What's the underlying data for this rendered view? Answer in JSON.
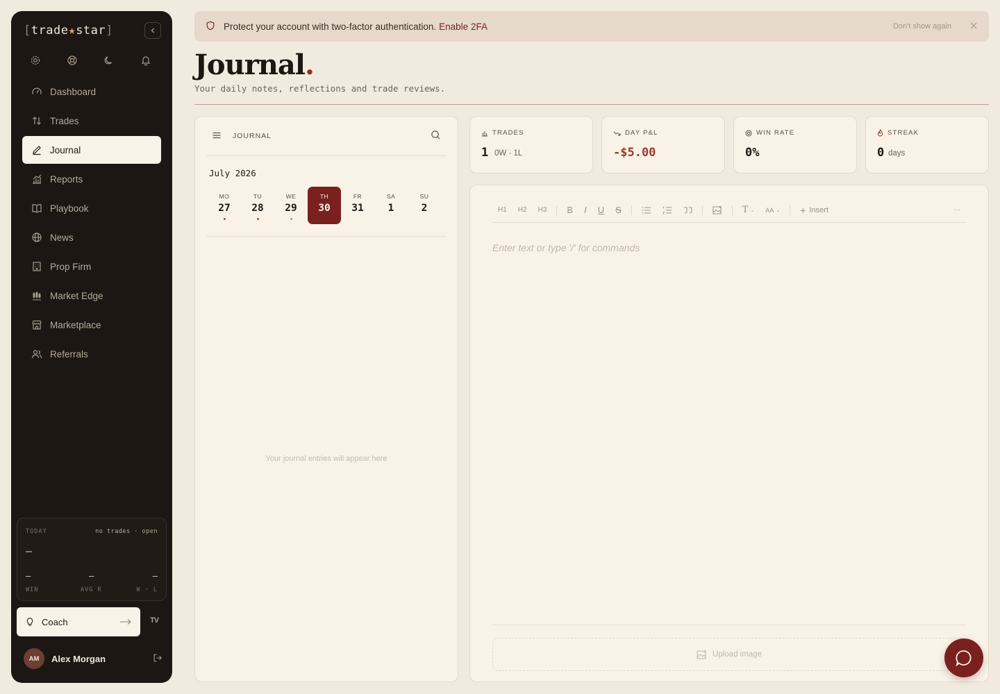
{
  "app": {
    "logo_word1": "trade",
    "logo_word2": "star",
    "logo_open": "[",
    "logo_close": "]"
  },
  "sidebar": {
    "utilities": [
      "gear-icon",
      "lifebuoy-icon",
      "moon-icon",
      "bell-icon"
    ],
    "items": [
      {
        "label": "Dashboard",
        "icon": "gauge-icon"
      },
      {
        "label": "Trades",
        "icon": "arrows-updown-icon"
      },
      {
        "label": "Journal",
        "icon": "pencil-icon"
      },
      {
        "label": "Reports",
        "icon": "chart-icon"
      },
      {
        "label": "Playbook",
        "icon": "book-icon"
      },
      {
        "label": "News",
        "icon": "globe-icon"
      },
      {
        "label": "Prop Firm",
        "icon": "building-icon"
      },
      {
        "label": "Market Edge",
        "icon": "candles-icon"
      },
      {
        "label": "Marketplace",
        "icon": "store-icon"
      },
      {
        "label": "Referrals",
        "icon": "users-icon"
      }
    ],
    "active_index": 2,
    "today": {
      "label": "TODAY",
      "status": "no trades · open",
      "main_value": "—",
      "stats": [
        {
          "value": "—",
          "label": "WIN"
        },
        {
          "value": "—",
          "label": "AVG R"
        },
        {
          "value": "—",
          "label": "W · L"
        }
      ]
    },
    "coach_label": "Coach",
    "tv_logo": "TV",
    "user": {
      "initials": "AM",
      "name": "Alex Morgan"
    }
  },
  "banner": {
    "text": "Protect your account with two-factor authentication.",
    "link": "Enable 2FA",
    "dismiss": "Don't show again"
  },
  "page": {
    "title": "Journal",
    "title_dot": ".",
    "subtitle": "Your daily notes, reflections and trade reviews."
  },
  "calendar": {
    "header_label": "JOURNAL",
    "month": "July 2026",
    "days": [
      {
        "dow": "MO",
        "date": "27",
        "mark": true
      },
      {
        "dow": "TU",
        "date": "28",
        "mark": true
      },
      {
        "dow": "WE",
        "date": "29",
        "mark": true
      },
      {
        "dow": "TH",
        "date": "30",
        "mark": false
      },
      {
        "dow": "FR",
        "date": "31",
        "mark": false
      },
      {
        "dow": "SA",
        "date": "1",
        "mark": false
      },
      {
        "dow": "SU",
        "date": "2",
        "mark": false
      }
    ],
    "selected_index": 3,
    "empty_text": "Your journal entries will appear here"
  },
  "stats": [
    {
      "label": "TRADES",
      "icon": "bar-chart-icon",
      "value": "1",
      "sub": "0W · 1L"
    },
    {
      "label": "DAY P&L",
      "icon": "trend-down-icon",
      "value": "-$5.00",
      "sub": ""
    },
    {
      "label": "WIN RATE",
      "icon": "target-icon",
      "value": "0%",
      "sub": ""
    },
    {
      "label": "STREAK",
      "icon": "flame-icon",
      "value": "0",
      "sub": "days"
    }
  ],
  "editor": {
    "toolbar": {
      "h1": "H1",
      "h2": "H2",
      "h3": "H3",
      "bold": "B",
      "italic": "I",
      "underline": "U",
      "strike": "S",
      "text_type": "T",
      "font_size": "AA",
      "insert": "Insert",
      "more": "···"
    },
    "placeholder": "Enter text or type '/' for commands",
    "upload_label": "Upload image"
  },
  "colors": {
    "accent": "#7a2120",
    "sidebar_bg": "#1c1713",
    "page_bg": "#f1ebdf",
    "card_bg": "#f8f2e7",
    "negative": "#9b3a2c"
  }
}
